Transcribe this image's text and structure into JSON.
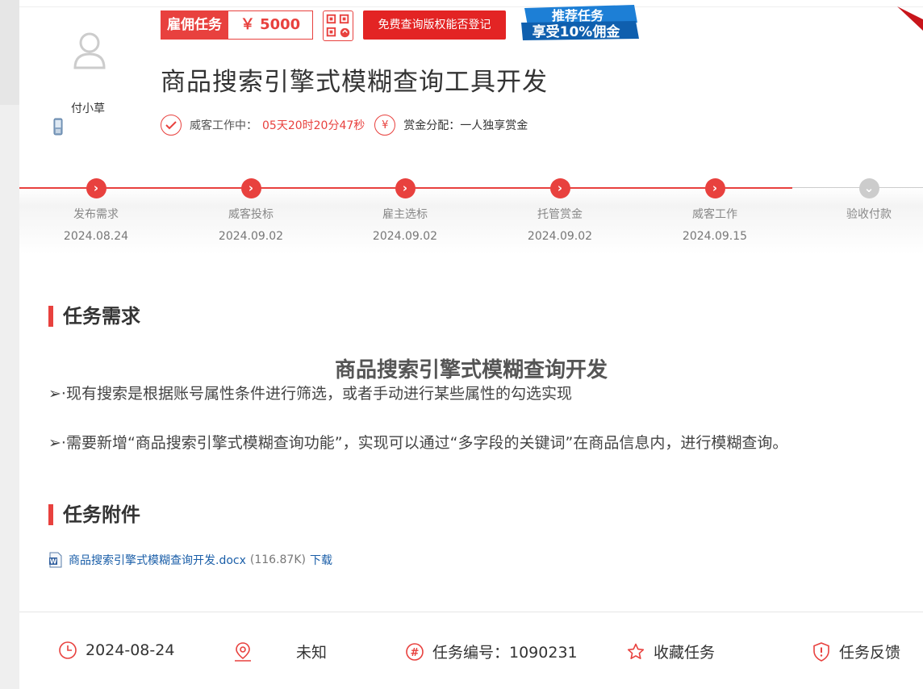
{
  "publisher": {
    "name": "付小草"
  },
  "badges": {
    "hire_label": "雇佣任务",
    "price": "￥ 5000",
    "free_query_label": "免费查询版权能否登记",
    "promo_line1": "推荐任务",
    "promo_line2": "享受10%佣金"
  },
  "task": {
    "title": "商品搜索引擎式模糊查询工具开发"
  },
  "status": {
    "working_label": "威客工作中：",
    "countdown": "05天20时20分47秒",
    "bounty_label": "赏金分配：一人独享赏金"
  },
  "steps": [
    {
      "label": "发布需求",
      "date": "2024.08.24",
      "done": true
    },
    {
      "label": "威客投标",
      "date": "2024.09.02",
      "done": true
    },
    {
      "label": "雇主选标",
      "date": "2024.09.02",
      "done": true
    },
    {
      "label": "托管赏金",
      "date": "2024.09.02",
      "done": true
    },
    {
      "label": "威客工作",
      "date": "2024.09.15",
      "done": true
    },
    {
      "label": "验收付款",
      "date": "",
      "done": false
    }
  ],
  "requirements": {
    "section_title": "任务需求",
    "heading": "商品搜索引擎式模糊查询开发",
    "lines": [
      "➢·现有搜索是根据账号属性条件进行筛选，或者手动进行某些属性的勾选实现",
      "➢·需要新增“商品搜索引擎式模糊查询功能”，实现可以通过“多字段的关键词”在商品信息内，进行模糊查询。"
    ]
  },
  "attachments": {
    "section_title": "任务附件",
    "file_name": "商品搜索引擎式模糊查询开发.docx",
    "file_size": "(116.87K)",
    "download_label": "下载"
  },
  "footer": {
    "date": "2024-08-24",
    "location": "未知",
    "task_number": "任务编号：1090231",
    "favorite_label": "收藏任务",
    "feedback_label": "任务反馈"
  },
  "colors": {
    "accent": "#e8413e",
    "link": "#1a5ea8"
  }
}
